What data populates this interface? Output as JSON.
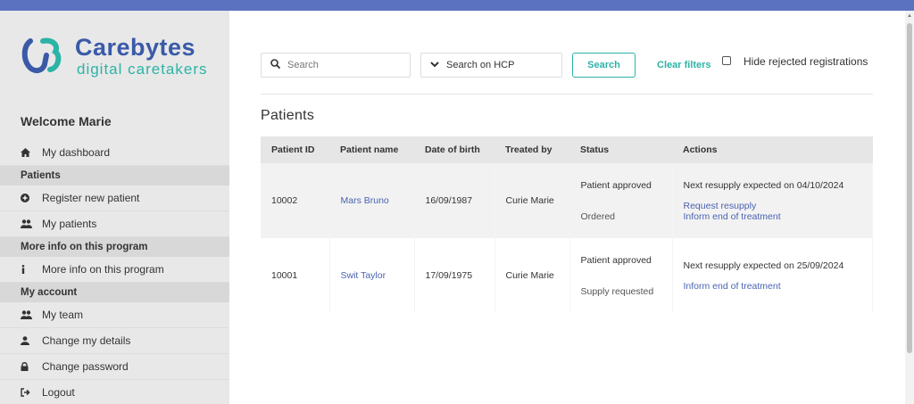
{
  "brand": {
    "name": "Carebytes",
    "tagline": "digital caretakers"
  },
  "sidebar": {
    "welcome": "Welcome Marie",
    "dashboard": {
      "icon": "home-icon",
      "label": "My dashboard"
    },
    "patients_header": "Patients",
    "register": {
      "icon": "plus-circle-icon",
      "label": "Register new patient"
    },
    "my_patients": {
      "icon": "users-icon",
      "label": "My patients"
    },
    "info_header": "More info on this program",
    "more_info": {
      "icon": "info-icon",
      "label": "More info on this program"
    },
    "account_header": "My account",
    "my_team": {
      "icon": "users-icon",
      "label": "My team"
    },
    "change_details": {
      "icon": "user-icon",
      "label": "Change my details"
    },
    "change_password": {
      "icon": "lock-icon",
      "label": "Change password"
    },
    "logout": {
      "icon": "sign-out-icon",
      "label": "Logout"
    }
  },
  "filters": {
    "search_placeholder": "Search",
    "hcp_label": "Search on HCP",
    "search_button": "Search",
    "clear_filters": "Clear filters",
    "hide_rejected": "Hide rejected registrations",
    "hide_rejected_checked": false
  },
  "page_title": "Patients",
  "table": {
    "headers": {
      "id": "Patient ID",
      "name": "Patient name",
      "dob": "Date of birth",
      "treated_by": "Treated by",
      "status": "Status",
      "actions": "Actions"
    },
    "rows": [
      {
        "id": "10002",
        "name": "Mars Bruno",
        "dob": "16/09/1987",
        "treated_by": "Curie Marie",
        "status_1": "Patient approved",
        "status_2": "Ordered",
        "next_resupply": "Next resupply expected on 04/10/2024",
        "action_1": "Request resupply",
        "action_2": "Inform end of treatment"
      },
      {
        "id": "10001",
        "name": "Swit Taylor",
        "dob": "17/09/1975",
        "treated_by": "Curie Marie",
        "status_1": "Patient approved",
        "status_2": "Supply requested",
        "next_resupply": "Next resupply expected on 25/09/2024",
        "action_1": "Inform end of treatment"
      }
    ]
  },
  "colors": {
    "accent": "#2cb3a6",
    "brand_blue": "#3a5aa8",
    "link": "#4a63b0",
    "topbar": "#5a72c0"
  }
}
